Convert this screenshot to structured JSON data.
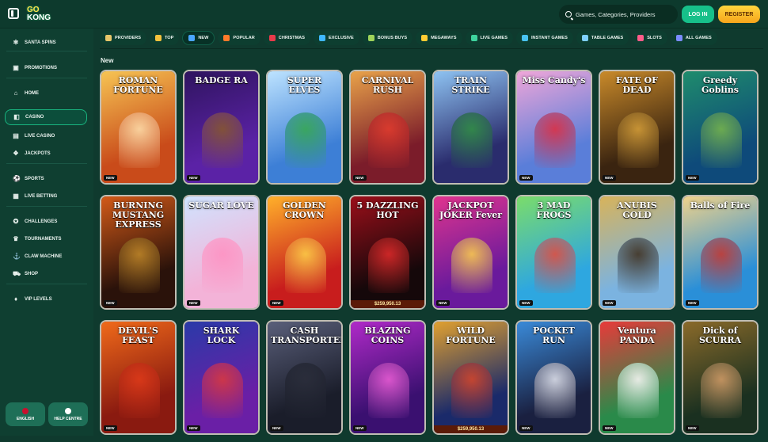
{
  "header": {
    "logo_line1": "GO",
    "logo_line2": "KONG",
    "search_placeholder": "Games, Categories, Providers",
    "login_label": "LOG IN",
    "register_label": "REGISTER"
  },
  "sidebar": {
    "items": [
      {
        "label": "SANTA SPINS",
        "icon": "snowflake-icon",
        "glyph": "✻"
      },
      {
        "label": "PROMOTIONS",
        "icon": "gift-icon",
        "glyph": "▣"
      },
      {
        "label": "HOME",
        "icon": "home-icon",
        "glyph": "⌂"
      },
      {
        "label": "CASINO",
        "icon": "casino-icon",
        "glyph": "◧"
      },
      {
        "label": "LIVE CASINO",
        "icon": "live-casino-icon",
        "glyph": "▤"
      },
      {
        "label": "JACKPOTS",
        "icon": "jackpot-icon",
        "glyph": "❖"
      },
      {
        "label": "SPORTS",
        "icon": "sports-icon",
        "glyph": "⚽"
      },
      {
        "label": "LIVE BETTING",
        "icon": "live-betting-icon",
        "glyph": "▦"
      },
      {
        "label": "CHALLENGES",
        "icon": "challenges-icon",
        "glyph": "✪"
      },
      {
        "label": "TOURNAMENTS",
        "icon": "tournaments-icon",
        "glyph": "♛"
      },
      {
        "label": "CLAW MACHINE",
        "icon": "claw-icon",
        "glyph": "⚓"
      },
      {
        "label": "SHOP",
        "icon": "shop-icon",
        "glyph": "⛟"
      },
      {
        "label": "VIP LEVELS",
        "icon": "vip-icon",
        "glyph": "♦"
      }
    ],
    "active_index": 3,
    "language_label": "ENGLISH",
    "help_label": "HELP CENTRE"
  },
  "tabs": [
    {
      "label": "PROVIDERS",
      "color": "#e7c66a"
    },
    {
      "label": "TOP",
      "color": "#f4c23d"
    },
    {
      "label": "NEW",
      "color": "#4aa6ff"
    },
    {
      "label": "POPULAR",
      "color": "#ff7a2a"
    },
    {
      "label": "CHRISTMAS",
      "color": "#e83a4a"
    },
    {
      "label": "EXCLUSIVE",
      "color": "#3fb8ff"
    },
    {
      "label": "BONUS BUYS",
      "color": "#9fd35a"
    },
    {
      "label": "MEGAWAYS",
      "color": "#ffcc33"
    },
    {
      "label": "LIVE GAMES",
      "color": "#3ed39e"
    },
    {
      "label": "INSTANT GAMES",
      "color": "#49c3f0"
    },
    {
      "label": "TABLE GAMES",
      "color": "#7fd0ff"
    },
    {
      "label": "SLOTS",
      "color": "#ff5c8a"
    },
    {
      "label": "ALL GAMES",
      "color": "#7b8cff"
    }
  ],
  "active_tab": 2,
  "section_title": "New",
  "games": [
    {
      "title": "ROMAN FORTUNE",
      "bg1": "#c94b1a",
      "bg2": "#f6c453",
      "fig": "#ffe2b0",
      "new": true
    },
    {
      "title": "BADGE RA",
      "bg1": "#5b22a6",
      "bg2": "#2f145f",
      "fig": "#8a5a2a",
      "new": true
    },
    {
      "title": "SUPER ELVES",
      "bg1": "#3d7fd6",
      "bg2": "#bde3ff",
      "fig": "#34a84a",
      "new": false
    },
    {
      "title": "CARNIVAL RUSH",
      "bg1": "#7b1c2a",
      "bg2": "#e9a34a",
      "fig": "#e33a2d",
      "new": true
    },
    {
      "title": "TRAIN STRIKE",
      "bg1": "#2a2c6d",
      "bg2": "#8ec3f2",
      "fig": "#2f8f3f",
      "new": false
    },
    {
      "title": "Miss Candy's",
      "bg1": "#5a7ed9",
      "bg2": "#f0a6d9",
      "fig": "#e02a3b",
      "new": true
    },
    {
      "title": "FATE OF DEAD",
      "bg1": "#3a2410",
      "bg2": "#c98a2a",
      "fig": "#d8a13a",
      "new": true
    },
    {
      "title": "Greedy Goblins",
      "bg1": "#0e4a7a",
      "bg2": "#1f8c6c",
      "fig": "#7bb84a",
      "new": true
    },
    {
      "title": "BURNING MUSTANG EXPRESS",
      "bg1": "#2a120a",
      "bg2": "#d35a18",
      "fig": "#c28a2a",
      "new": true
    },
    {
      "title": "SUGAR LOVE",
      "bg1": "#f3b3d8",
      "bg2": "#cfe4ff",
      "fig": "#ff8fc0",
      "new": true
    },
    {
      "title": "GOLDEN CROWN",
      "bg1": "#c81d1d",
      "bg2": "#ffb02a",
      "fig": "#ffd54a",
      "new": true
    },
    {
      "title": "5 DAZZLING HOT",
      "bg1": "#15080a",
      "bg2": "#9b0f1a",
      "fig": "#e52b2b",
      "new": false,
      "jackpot": "$259,950.13"
    },
    {
      "title": "JACKPOT JOKER Fever",
      "bg1": "#6a1a9c",
      "bg2": "#e0358e",
      "fig": "#ffd44a",
      "new": true
    },
    {
      "title": "3 MAD FROGS",
      "bg1": "#2ea7e0",
      "bg2": "#7bdc6a",
      "fig": "#e9473a",
      "new": true
    },
    {
      "title": "ANUBIS GOLD",
      "bg1": "#7bb3e0",
      "bg2": "#d8b35a",
      "fig": "#3a2a1a",
      "new": true
    },
    {
      "title": "Balls of Fire",
      "bg1": "#2a8fd8",
      "bg2": "#f0d28a",
      "fig": "#c8322a",
      "new": true
    },
    {
      "title": "DEVIL'S FEAST",
      "bg1": "#8a1a10",
      "bg2": "#f06a1a",
      "fig": "#e03a1a",
      "new": true
    },
    {
      "title": "SHARK LOCK",
      "bg1": "#6a1fa6",
      "bg2": "#2a3aa8",
      "fig": "#e0393a",
      "new": true
    },
    {
      "title": "CASH TRANSPORTER",
      "bg1": "#1a1d2a",
      "bg2": "#5a5f7a",
      "fig": "#2a2d3a",
      "new": true
    },
    {
      "title": "BLAZING COINS",
      "bg1": "#3a1070",
      "bg2": "#b02ac8",
      "fig": "#f060d8",
      "new": true
    },
    {
      "title": "WILD FORTUNE",
      "bg1": "#1a2a6a",
      "bg2": "#e0a030",
      "fig": "#d8452a",
      "new": false,
      "jackpot": "$259,950.13"
    },
    {
      "title": "POCKET RUN",
      "bg1": "#1a2040",
      "bg2": "#3a8ad8",
      "fig": "#e8e8f0",
      "new": true
    },
    {
      "title": "Ventura PANDA",
      "bg1": "#2a8a4a",
      "bg2": "#e83a3a",
      "fig": "#ffffff",
      "new": true
    },
    {
      "title": "Dick of SCURRA",
      "bg1": "#1a3020",
      "bg2": "#8a6a2a",
      "fig": "#d8a06a",
      "new": true
    }
  ],
  "new_badge": "NEW"
}
